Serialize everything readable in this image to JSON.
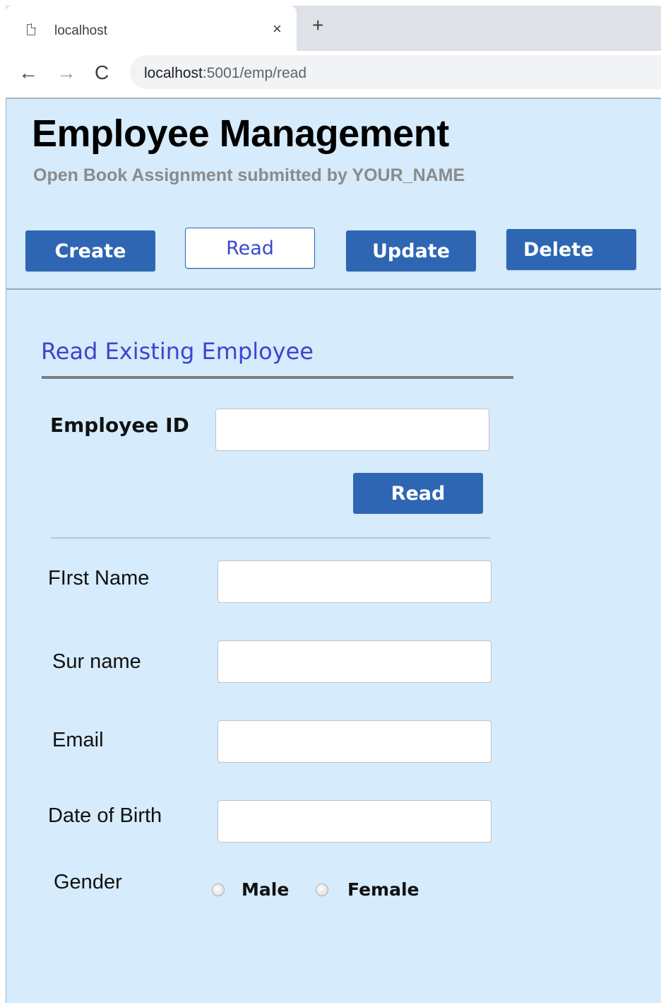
{
  "browser": {
    "tab_title": "localhost",
    "close_glyph": "×",
    "new_tab_glyph": "+",
    "back_glyph": "←",
    "forward_glyph": "→",
    "reload_glyph": "C",
    "url_host": "localhost",
    "url_path": ":5001/emp/read"
  },
  "header": {
    "title": "Employee Management",
    "subtitle": "Open Book Assignment submitted by YOUR_NAME"
  },
  "nav": {
    "create": "Create",
    "read": "Read",
    "update": "Update",
    "delete": "Delete",
    "active": "Read"
  },
  "section": {
    "title": "Read Existing Employee"
  },
  "form": {
    "employee_id_label": "Employee ID",
    "employee_id_value": "",
    "read_button": "Read",
    "first_name_label": "FIrst Name",
    "first_name_value": "",
    "surname_label": "Sur name",
    "surname_value": "",
    "email_label": "Email",
    "email_value": "",
    "dob_label": "Date of Birth",
    "dob_value": "",
    "gender_label": "Gender",
    "gender_options": [
      "Male",
      "Female"
    ]
  },
  "colors": {
    "page_background": "#d6ebfc",
    "button_blue": "#2e66b3",
    "section_title": "#3a46cf",
    "subtitle_gray": "#8b8b8b"
  }
}
